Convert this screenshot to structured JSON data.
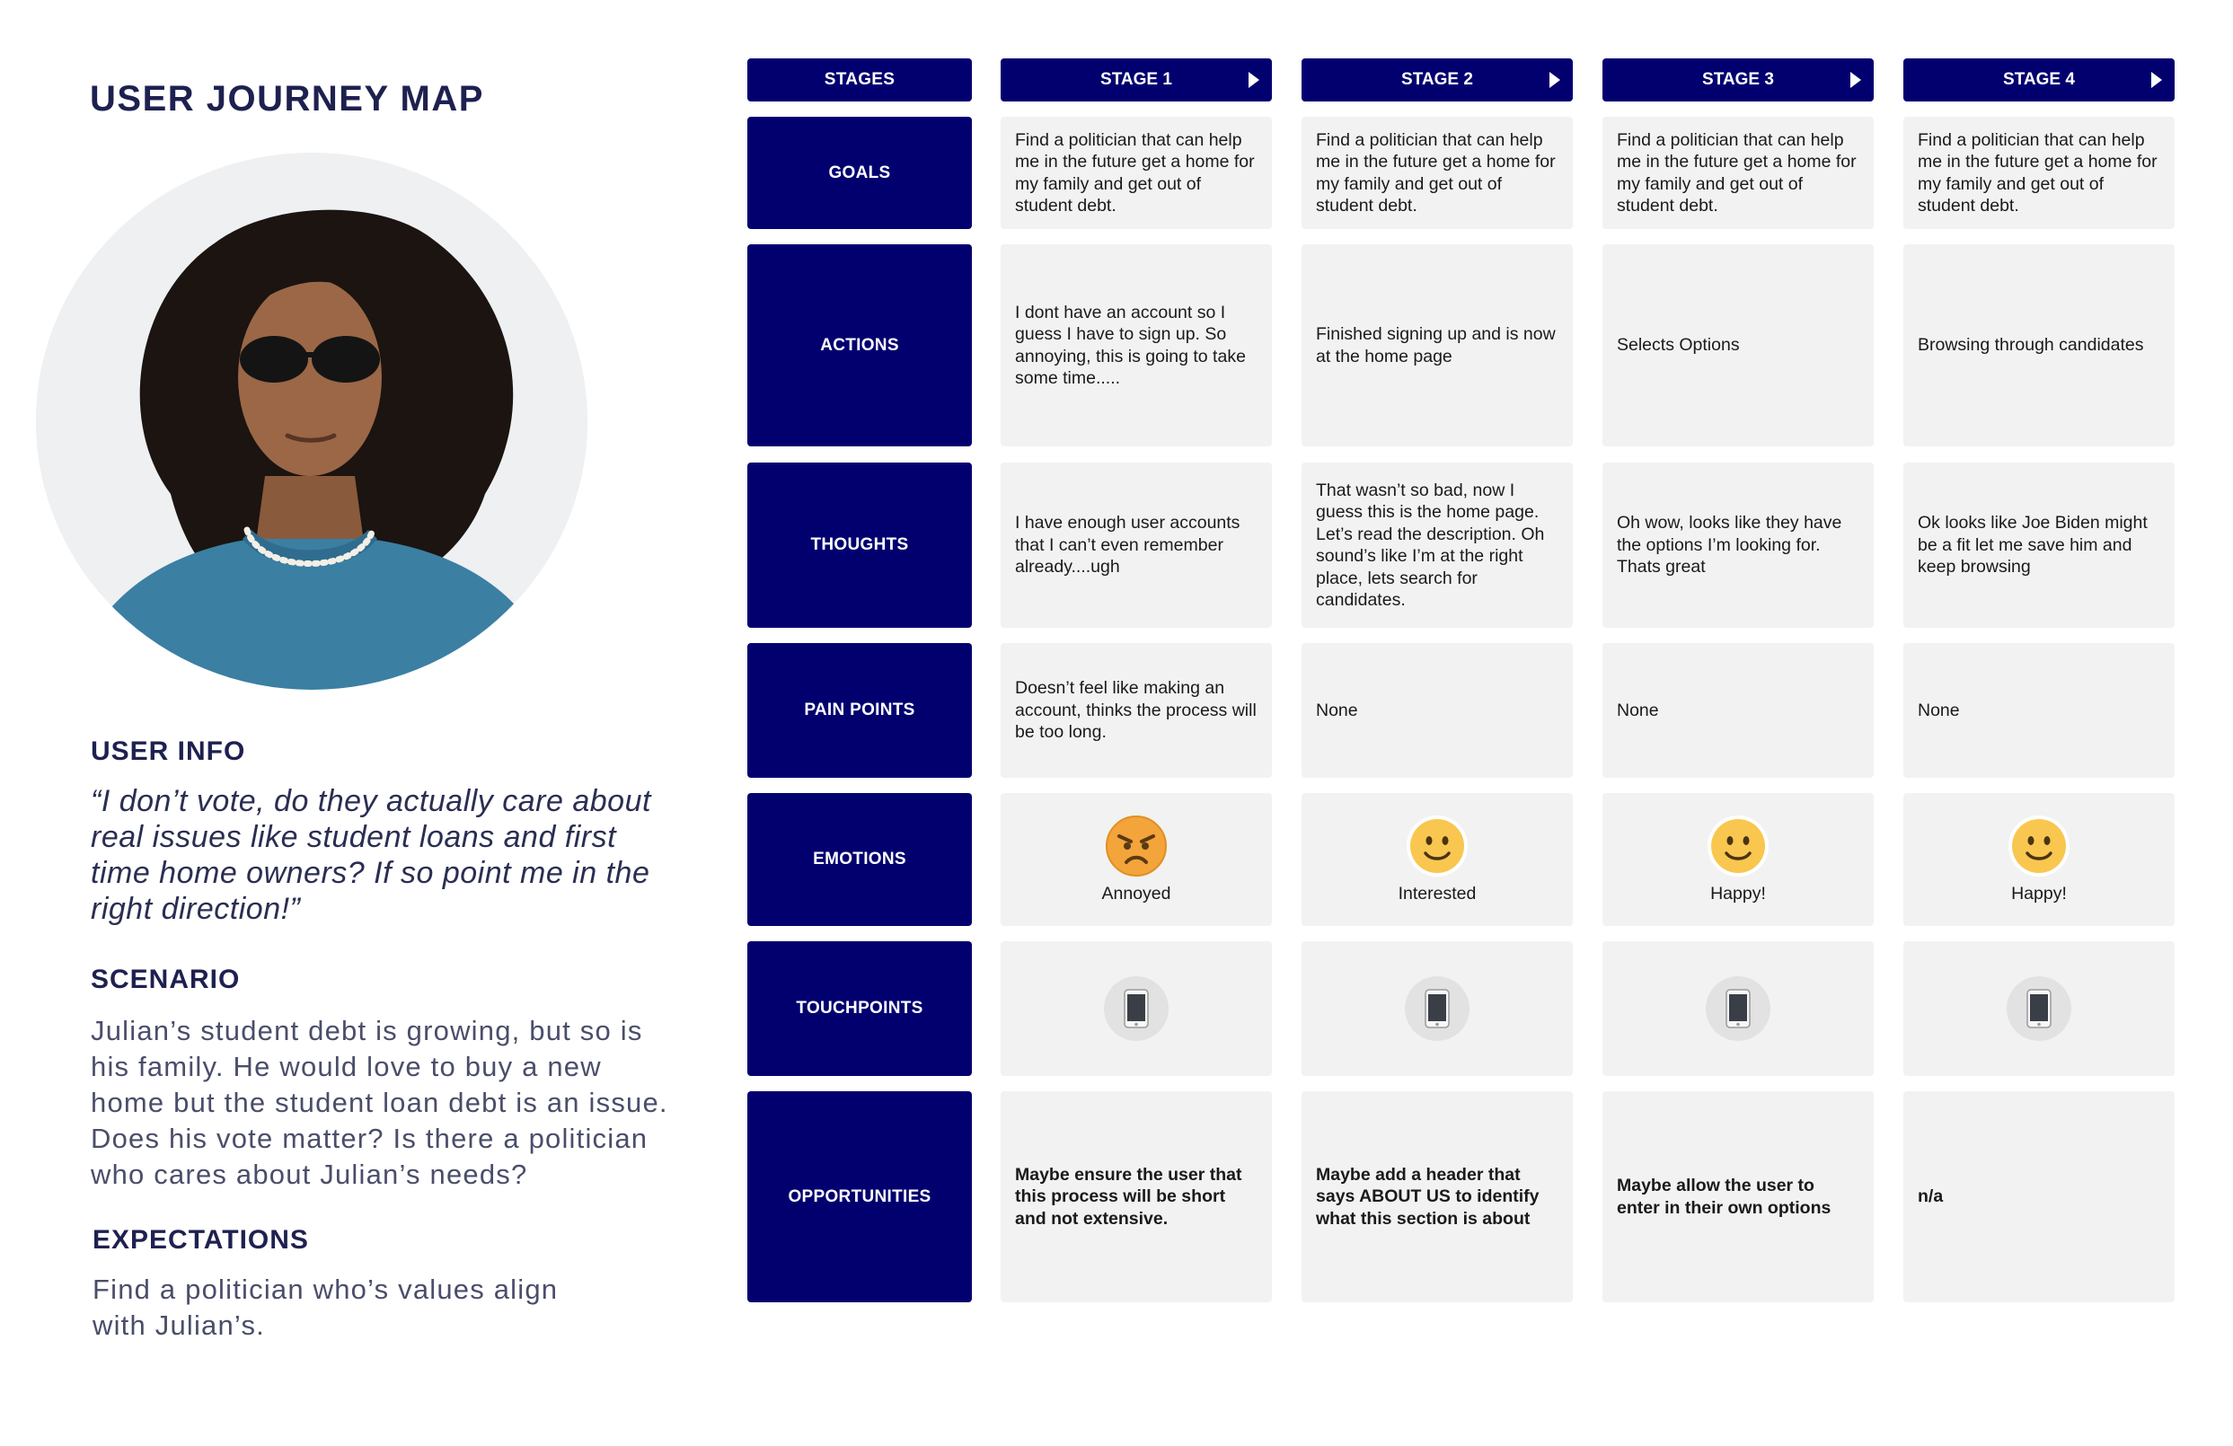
{
  "title": "USER JOURNEY MAP",
  "user_info": {
    "heading": "USER INFO",
    "quote": "“I don’t vote, do they actually care about real issues like student loans and first time home owners? If so point me in the right direction!”"
  },
  "scenario": {
    "heading": "SCENARIO",
    "text": "Julian’s student debt is growing, but so is his family. He would love to buy a new home but the student loan debt is an issue. Does his vote matter? Is there a politician who cares about Julian’s needs?"
  },
  "expectations": {
    "heading": "EXPECTATIONS",
    "text": "Find a politician who’s values align with Julian’s."
  },
  "header_label": "STAGES",
  "stages": [
    "STAGE 1",
    "STAGE 2",
    "STAGE 3",
    "STAGE 4"
  ],
  "rows": {
    "goals": {
      "label": "GOALS",
      "cells": [
        "Find a politician that can help me in the future get a home for my family and get out of student debt.",
        "Find a politician that can help me in the future get a home for my family and get out of student debt.",
        "Find a politician that can help me in the future get a home for my family and get out of student debt.",
        "Find a politician that can help me in the future get a home for my family and get out of student debt."
      ]
    },
    "actions": {
      "label": "ACTIONS",
      "cells": [
        "I dont have an account so I guess I have to sign up. So annoying, this is going to take some time.....",
        "Finished signing up and is now at the home page",
        "Selects Options",
        "Browsing through candidates"
      ]
    },
    "thoughts": {
      "label": "THOUGHTS",
      "cells": [
        "I have enough user accounts that I can’t even remember already....ugh",
        "That wasn’t so bad, now I guess this is the home page. Let’s read the description. Oh sound’s like I’m at the right place, lets search for candidates.",
        "Oh wow, looks like they have the options I’m looking for. Thats great",
        "Ok looks like Joe Biden might be a fit let me save him and keep browsing"
      ]
    },
    "pain_points": {
      "label": "PAIN POINTS",
      "cells": [
        "Doesn’t feel like making an account, thinks the process will be too long.",
        "None",
        "None",
        "None"
      ]
    },
    "emotions": {
      "label": "EMOTIONS",
      "cells": [
        {
          "text": "Annoyed",
          "icon": "angry-face-icon"
        },
        {
          "text": "Interested",
          "icon": "smiling-face-icon"
        },
        {
          "text": "Happy!",
          "icon": "smiling-face-icon"
        },
        {
          "text": "Happy!",
          "icon": "smiling-face-icon"
        }
      ]
    },
    "touchpoints": {
      "label": "TOUCHPOINTS",
      "icon": "mobile-phone-icon"
    },
    "opportunities": {
      "label": "OPPORTUNITIES",
      "cells": [
        "Maybe ensure the user that this process will be short and not extensive.",
        "Maybe add a header that says ABOUT US to identify what this section is about",
        "Maybe allow the user to enter in their own options",
        "n/a"
      ]
    }
  },
  "colors": {
    "navy": "#02006f",
    "cell_bg": "#f2f2f2",
    "title": "#1e2150",
    "emoji_yellow": "#f9c74f",
    "emoji_orange": "#f3a43a"
  }
}
